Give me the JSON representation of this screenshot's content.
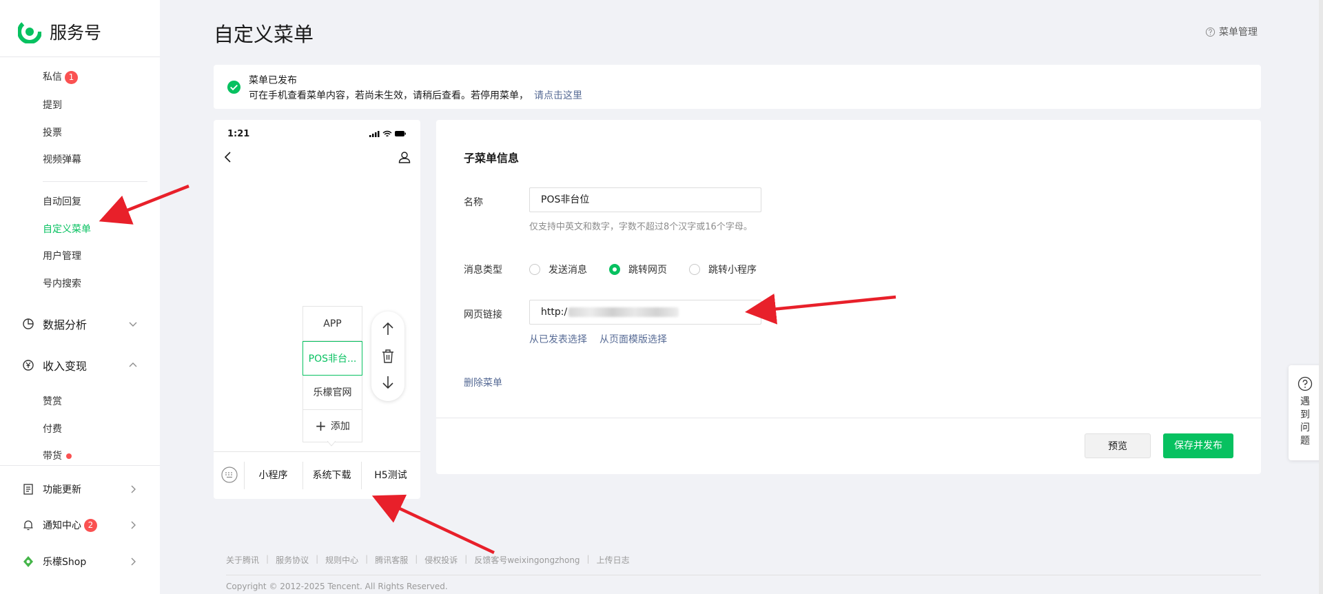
{
  "brand": {
    "name": "服务号"
  },
  "sidebar": {
    "items_top": [
      {
        "label": "私信",
        "badge": "1"
      },
      {
        "label": "提到"
      },
      {
        "label": "投票"
      },
      {
        "label": "视频弹幕"
      }
    ],
    "items_mid": [
      {
        "label": "自动回复"
      },
      {
        "label": "自定义菜单",
        "active": true
      },
      {
        "label": "用户管理"
      },
      {
        "label": "号内搜索"
      }
    ],
    "group_data": {
      "label": "数据分析"
    },
    "group_income": {
      "label": "收入变现"
    },
    "items_income": [
      {
        "label": "赞赏"
      },
      {
        "label": "付费"
      },
      {
        "label": "带货"
      }
    ],
    "group_update": {
      "label": "功能更新"
    },
    "group_notice": {
      "label": "通知中心",
      "badge": "2"
    },
    "group_shop": {
      "label": "乐檬Shop"
    }
  },
  "header": {
    "title": "自定义菜单",
    "menu_manage": "菜单管理"
  },
  "notice": {
    "title": "菜单已发布",
    "body": "可在手机查看菜单内容，若尚未生效，请稍后查看。若停用菜单，",
    "link": "请点击这里"
  },
  "phone": {
    "time": "1:21",
    "submenu": [
      "APP",
      "POS非台...",
      "乐檬官网"
    ],
    "add_label": "添加",
    "bar_items": [
      "小程序",
      "系统下载",
      "H5测试"
    ]
  },
  "panel": {
    "title": "子菜单信息",
    "name_label": "名称",
    "name_value": "POS非台位",
    "name_hint": "仅支持中英文和数字，字数不超过8个汉字或16个字母。",
    "type_label": "消息类型",
    "type_options": [
      "发送消息",
      "跳转网页",
      "跳转小程序"
    ],
    "url_label": "网页链接",
    "url_value": "http:/",
    "link_published": "从已发表选择",
    "link_template": "从页面模版选择",
    "delete": "删除菜单",
    "preview": "预览",
    "publish": "保存并发布"
  },
  "help": {
    "text": "遇到问题"
  },
  "footer": {
    "links": [
      "关于腾讯",
      "服务协议",
      "规则中心",
      "腾讯客服",
      "侵权投诉",
      "反馈客号weixingongzhong",
      "上传日志"
    ],
    "copyright": "Copyright © 2012-2025 Tencent. All Rights Reserved."
  },
  "colors": {
    "accent": "#07c160",
    "link": "#576b95",
    "badge": "#fa5151",
    "annotation": "#e8202a"
  }
}
